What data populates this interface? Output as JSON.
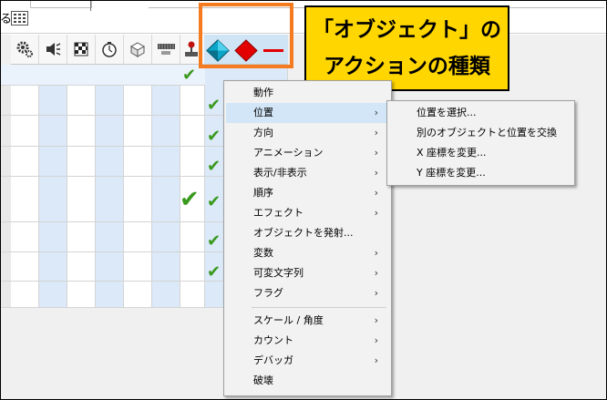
{
  "toolbar": {
    "fragment_text": "る"
  },
  "header_icons": [
    {
      "name": "gear-icon"
    },
    {
      "name": "speaker-icon"
    },
    {
      "name": "checker-flag-icon"
    },
    {
      "name": "timer-icon"
    },
    {
      "name": "box-icon"
    },
    {
      "name": "keyboard-icon"
    },
    {
      "name": "joystick-icon"
    }
  ],
  "highlighted_icons": [
    {
      "name": "cyan-diamond-icon",
      "color": "#0aa5c8"
    },
    {
      "name": "red-diamond-icon",
      "color": "#e30000"
    },
    {
      "name": "red-line-icon",
      "color": "#e30000"
    }
  ],
  "callout": {
    "line1": "「オブジェクト」の",
    "line2": "アクションの種類"
  },
  "check_glyph": "✔",
  "context_menu": {
    "items": [
      {
        "label": "動作",
        "submenu": false
      },
      {
        "label": "位置",
        "submenu": true,
        "active": true
      },
      {
        "label": "方向",
        "submenu": true
      },
      {
        "label": "アニメーション",
        "submenu": true
      },
      {
        "label": "表示/非表示",
        "submenu": true
      },
      {
        "label": "順序",
        "submenu": true
      },
      {
        "label": "エフェクト",
        "submenu": true
      },
      {
        "label": "オブジェクトを発射...",
        "submenu": false
      },
      {
        "label": "変数",
        "submenu": true
      },
      {
        "label": "可変文字列",
        "submenu": true
      },
      {
        "label": "フラグ",
        "submenu": true
      },
      {
        "label": "スケール / 角度",
        "submenu": true
      },
      {
        "label": "カウント",
        "submenu": true
      },
      {
        "label": "デバッガ",
        "submenu": true
      },
      {
        "label": "破壊",
        "submenu": false
      }
    ],
    "arrow_glyph": "›"
  },
  "submenu": {
    "items": [
      {
        "label": "位置を選択..."
      },
      {
        "label": "別のオブジェクトと位置を交換"
      },
      {
        "label": "X 座標を変更..."
      },
      {
        "label": "Y 座標を変更..."
      }
    ]
  },
  "colors": {
    "highlight_border": "#f47b20",
    "callout_bg": "#ffd600",
    "check": "#3a9a1e",
    "menu_hover": "#d2e6f7"
  }
}
